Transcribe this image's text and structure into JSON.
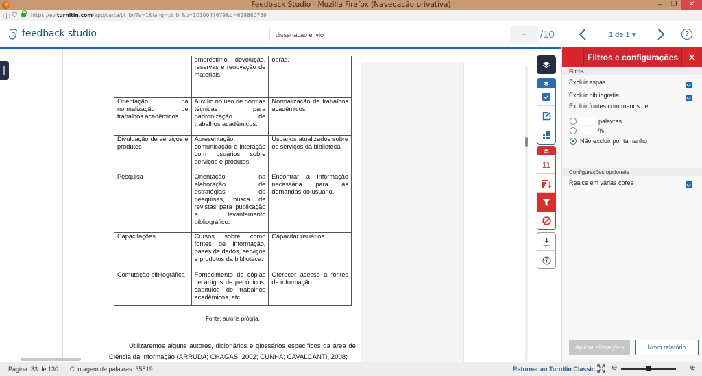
{
  "browser": {
    "window_title": "Feedback Studio - Mozilla Firefox (Navegação privativa)",
    "url_prefix": "https://ev.",
    "url_domain": "turnitin.com",
    "url_path": "/app/carta/pt_br/?s=1&lang=pt_br&u=1010047679&o=618860789",
    "minimize": "–",
    "maximize": "❐",
    "close": "✕"
  },
  "header": {
    "app_name": "feedback studio",
    "document_title": "dissertacao envio",
    "grade_placeholder": "--",
    "grade_total": "/10",
    "pager": "1 de 1 ▾",
    "help": "?"
  },
  "document": {
    "table_rows": [
      [
        "",
        "empréstimo, devolução, reservas e renovação de materiais.",
        "obras."
      ],
      [
        "Orientação na normalização de trabalhos acadêmicos",
        "Auxílio no uso de normas técnicas para padronização de trabalhos acadêmicos.",
        "Normalização de trabalhos acadêmicos."
      ],
      [
        "Divulgação de serviços e produtos",
        "Apresentação, comunicação e interação com usuários sobre serviços e produtos.",
        "Usuários atualizados sobre os serviços da biblioteca."
      ],
      [
        "Pesquisa",
        "Orientação na elaboração de estratégias de pesquisas, busca de revistas para publicação e levantamento bibliográfico.",
        "Encontrar a informação necessária para as demandas do usuário."
      ],
      [
        "Capacitações",
        "Cursos sobre como fontes de informação, bases de dados, serviços e produtos da biblioteca.",
        "Capacitar usuários."
      ],
      [
        "Comutação bibliográfica",
        "Fornecimento de cópias de artigos de periódicos, capítulos de trabalhos acadêmicos, etc.",
        "Oferecer acesso a fontes de informação."
      ]
    ],
    "caption": "Fonte: autoria própria.",
    "paragraph_line1": "Utilizaremos alguns autores, dicionários e glossários específicos da área de",
    "paragraph_line2": "Ciência da Informação (ARRUDA; CHAGAS, 2002; CUNHA; CAVALCANTI, 2008;"
  },
  "toolbar": {
    "similarity_count": "11"
  },
  "panel": {
    "title": "Filtros e configurações",
    "filters_section": "Filtros",
    "exclude_quotes": {
      "label": "Excluir aspas",
      "checked": true
    },
    "exclude_bibliography": {
      "label": "Excluir bibliografia",
      "checked": true
    },
    "exclude_sources_label": "Excluir fontes com menos de:",
    "radio_words": {
      "label": "palavras",
      "value": "",
      "selected": false
    },
    "radio_percent": {
      "label": "%",
      "value": "",
      "selected": false
    },
    "radio_no_exclude": {
      "label": "Não excluir por tamanho",
      "selected": true
    },
    "optional_section": "Configurações opcionais",
    "multi_color": {
      "label": "Realce em várias cores",
      "checked": true
    },
    "apply_button": "Aplicar alterações",
    "new_report_button": "Novo relatório"
  },
  "status": {
    "page": "Página: 33 de 130",
    "word_count": "Contagem de palavras: 35519",
    "return_link": "Retornar ao Turnitin Classic",
    "zoom_level": 0.5
  },
  "colors": {
    "accent_blue": "#1565b7",
    "accent_red": "#d8262d",
    "dark_nav": "#252e40"
  }
}
